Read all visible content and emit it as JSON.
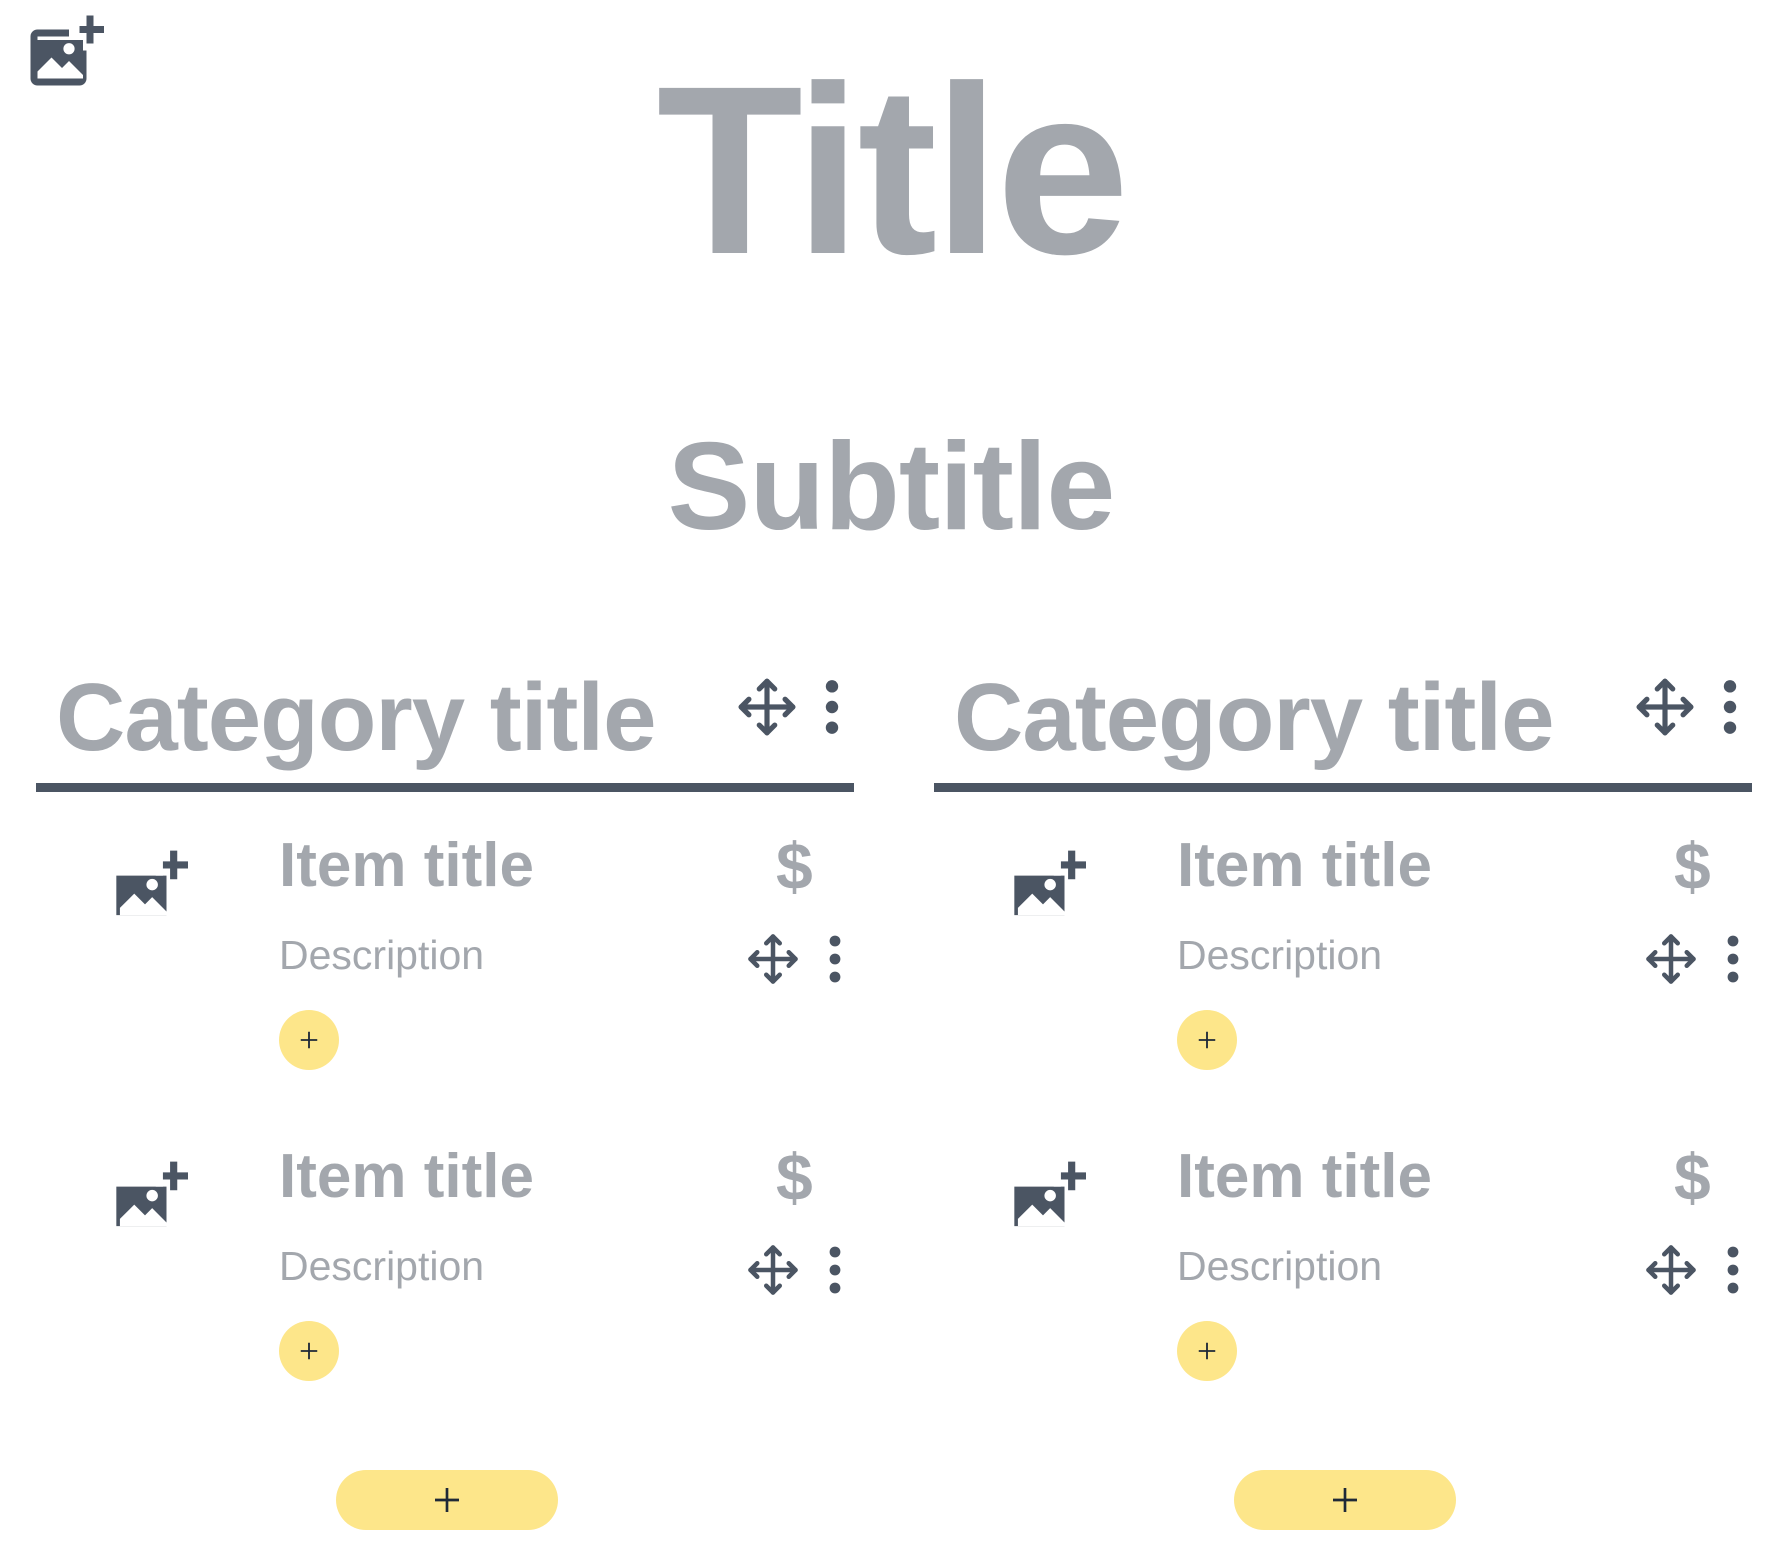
{
  "page": {
    "title": "Title",
    "subtitle": "Subtitle"
  },
  "colors": {
    "placeholder_text": "#a3a7ad",
    "icon": "#4b5563",
    "add_button": "#fde68a",
    "add_button_icon": "#1f2937"
  },
  "icons": {
    "add_image": "image-plus-icon",
    "move": "move-arrows-icon",
    "more": "more-vertical-icon",
    "add": "plus-icon"
  },
  "categories": [
    {
      "title": "Category title",
      "items": [
        {
          "title": "Item title",
          "price": "$",
          "description": "Description"
        },
        {
          "title": "Item title",
          "price": "$",
          "description": "Description"
        }
      ]
    },
    {
      "title": "Category title",
      "items": [
        {
          "title": "Item title",
          "price": "$",
          "description": "Description"
        },
        {
          "title": "Item title",
          "price": "$",
          "description": "Description"
        }
      ]
    }
  ]
}
